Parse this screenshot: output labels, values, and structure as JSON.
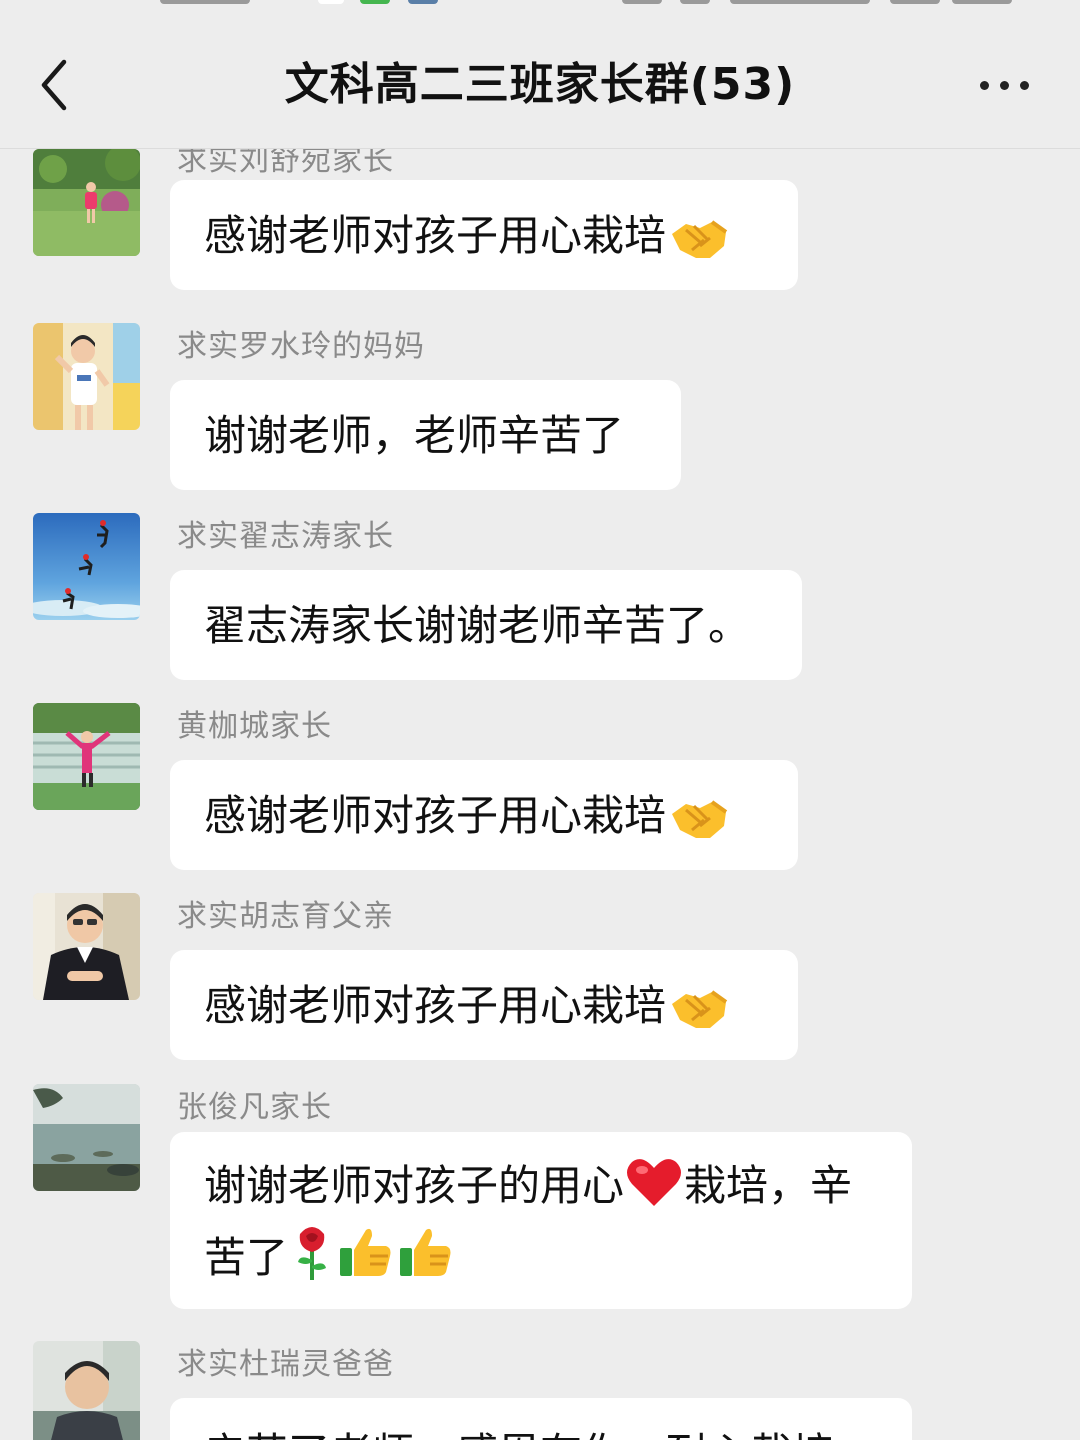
{
  "header": {
    "title": "文科高二三班家长群(53)",
    "back_icon": "chevron-left-icon",
    "more_icon": "more-dots-icon"
  },
  "colors": {
    "background": "#ededed",
    "bubble": "#ffffff",
    "sender_name": "#8a8a8a",
    "text": "#111111"
  },
  "messages": [
    {
      "sender": "求实刘舒宛家长",
      "text": "感谢老师对孩子用心栽培",
      "emoji": [
        "handshake-emoji"
      ],
      "avatar": "avatar-girl-on-lawn"
    },
    {
      "sender": "求实罗水玲的妈妈",
      "text": "谢谢老师，老师辛苦了",
      "emoji": [],
      "avatar": "avatar-girl-in-classroom"
    },
    {
      "sender": "求实翟志涛家长",
      "text": "翟志涛家长谢谢老师辛苦了。",
      "emoji": [],
      "avatar": "avatar-skydivers"
    },
    {
      "sender": "黄枷城家长",
      "text": "感谢老师对孩子用心栽培",
      "emoji": [
        "handshake-emoji"
      ],
      "avatar": "avatar-woman-at-waterfall"
    },
    {
      "sender": "求实胡志育父亲",
      "text": "感谢老师对孩子用心栽培",
      "emoji": [
        "handshake-emoji"
      ],
      "avatar": "avatar-man-in-suit"
    },
    {
      "sender": "张俊凡家长",
      "text_part1": "谢谢老师对孩子的用心",
      "text_part2": "栽培，辛",
      "text_part3": "苦了",
      "emoji": [
        "red-heart-emoji",
        "rose-emoji",
        "thumbs-up-emoji",
        "thumbs-up-emoji"
      ],
      "avatar": "avatar-lake-landscape"
    },
    {
      "sender": "求实杜瑞灵爸爸",
      "text": "辛苦了老师，感恩有你，耐心栽培",
      "emoji": [],
      "avatar": "avatar-man-portrait"
    }
  ]
}
